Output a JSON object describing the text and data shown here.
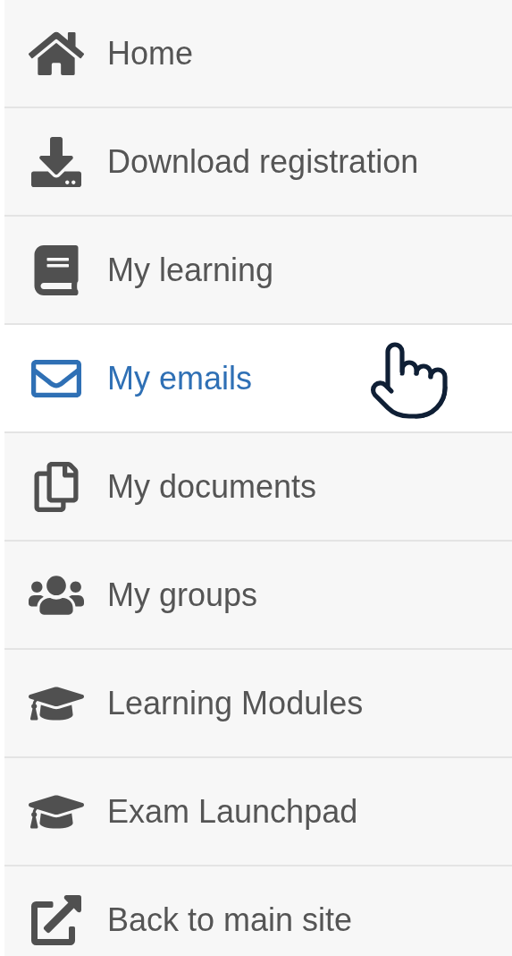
{
  "menu": {
    "items": [
      {
        "label": "Home",
        "selected": false
      },
      {
        "label": "Download registration",
        "selected": false
      },
      {
        "label": "My learning",
        "selected": false
      },
      {
        "label": "My emails",
        "selected": true
      },
      {
        "label": "My documents",
        "selected": false
      },
      {
        "label": "My groups",
        "selected": false
      },
      {
        "label": "Learning Modules",
        "selected": false
      },
      {
        "label": "Exam Launchpad",
        "selected": false
      },
      {
        "label": "Back to main site",
        "selected": false
      }
    ]
  }
}
